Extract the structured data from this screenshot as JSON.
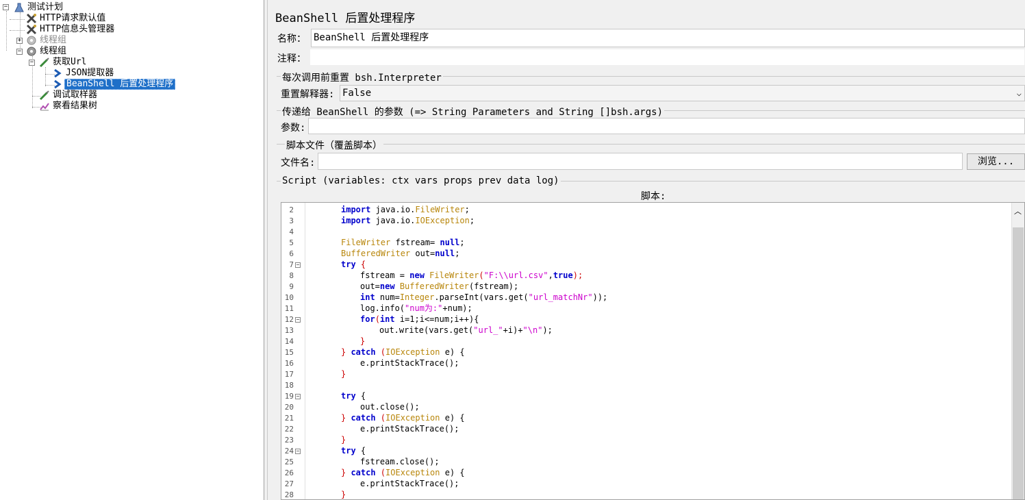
{
  "tree": {
    "items": [
      {
        "label": "测试计划",
        "icon": "test-plan-icon",
        "level": 0
      },
      {
        "label": "HTTP请求默认值",
        "icon": "wrench-icon",
        "level": 1
      },
      {
        "label": "HTTP信息头管理器",
        "icon": "wrench-icon",
        "level": 1
      },
      {
        "label": "线程组",
        "icon": "thread-group-icon",
        "level": 1,
        "disabled": true
      },
      {
        "label": "线程组",
        "icon": "thread-group-icon",
        "level": 1
      },
      {
        "label": "获取Url",
        "icon": "sampler-icon",
        "level": 2
      },
      {
        "label": "JSON提取器",
        "icon": "post-processor-icon",
        "level": 3
      },
      {
        "label": "BeanShell 后置处理程序",
        "icon": "post-processor-icon",
        "level": 3,
        "selected": true
      },
      {
        "label": "调试取样器",
        "icon": "sampler-icon",
        "level": 2
      },
      {
        "label": "察看结果树",
        "icon": "listener-icon",
        "level": 2
      }
    ]
  },
  "panel": {
    "title": "BeanShell 后置处理程序",
    "name_label": "名称：",
    "name_value": "BeanShell 后置处理程序",
    "comment_label": "注释：",
    "comment_value": "",
    "reset_group_title": "每次调用前重置 bsh.Interpreter",
    "reset_label": "重置解释器:",
    "reset_value": "False",
    "params_group_title": "传递给 BeanShell 的参数 (=> String Parameters and String []bsh.args)",
    "params_label": "参数:",
    "params_value": "",
    "file_group_title": "脚本文件（覆盖脚本）",
    "file_label": "文件名:",
    "file_value": "",
    "browse_label": "浏览...",
    "script_group_title": "Script (variables: ctx vars props prev data log)",
    "script_label": "脚本:"
  },
  "script_lines": [
    {
      "n": "2",
      "fold": false
    },
    {
      "n": "3",
      "fold": false
    },
    {
      "n": "4",
      "fold": false
    },
    {
      "n": "5",
      "fold": false
    },
    {
      "n": "6",
      "fold": false
    },
    {
      "n": "7",
      "fold": true
    },
    {
      "n": "8",
      "fold": false
    },
    {
      "n": "9",
      "fold": false
    },
    {
      "n": "10",
      "fold": false
    },
    {
      "n": "11",
      "fold": false
    },
    {
      "n": "12",
      "fold": true
    },
    {
      "n": "13",
      "fold": false
    },
    {
      "n": "14",
      "fold": false
    },
    {
      "n": "15",
      "fold": false
    },
    {
      "n": "16",
      "fold": false
    },
    {
      "n": "17",
      "fold": false
    },
    {
      "n": "18",
      "fold": false
    },
    {
      "n": "19",
      "fold": true
    },
    {
      "n": "20",
      "fold": false
    },
    {
      "n": "21",
      "fold": false
    },
    {
      "n": "22",
      "fold": false
    },
    {
      "n": "23",
      "fold": false
    },
    {
      "n": "24",
      "fold": true
    },
    {
      "n": "25",
      "fold": false
    },
    {
      "n": "26",
      "fold": false
    },
    {
      "n": "27",
      "fold": false
    },
    {
      "n": "28",
      "fold": false
    }
  ],
  "code": {
    "l2": [
      "import",
      " java.io.",
      "FileWriter",
      ";"
    ],
    "l3": [
      "import",
      " java.io.",
      "IOException",
      ";"
    ],
    "l5": [
      "FileWriter",
      " fstream= ",
      "null",
      ";"
    ],
    "l6": [
      "BufferedWriter",
      " out=",
      "null",
      ";"
    ],
    "l7": [
      "try",
      " ",
      "{"
    ],
    "l8": [
      "fstream = ",
      "new",
      " ",
      "FileWriter",
      "(",
      "\"F:\\\\url.csv\"",
      ",",
      "true",
      ");"
    ],
    "l9": [
      "out=",
      "new",
      " ",
      "BufferedWriter",
      "(fstream);"
    ],
    "l10": [
      "int",
      " num=",
      "Integer",
      ".parseInt(vars.get(",
      "\"url_matchNr\"",
      "));"
    ],
    "l11": [
      "log.info(",
      "\"num为:\"",
      "+num);"
    ],
    "l12": [
      "for",
      "(",
      "int",
      " i=1;i<=num;i++){"
    ],
    "l13": [
      "out.write(vars.get(",
      "\"url_\"",
      "+i)+",
      "\"\\n\"",
      ");"
    ],
    "l14": [
      "}"
    ],
    "l15": [
      "} ",
      "catch",
      " (",
      "IOException",
      " e) {"
    ],
    "l16": [
      "e.printStackTrace();"
    ],
    "l17": [
      "}"
    ],
    "l19": [
      "try",
      " {"
    ],
    "l20": [
      "out.close();"
    ],
    "l21": [
      "} ",
      "catch",
      " (",
      "IOException",
      " e) {"
    ],
    "l22": [
      "e.printStackTrace();"
    ],
    "l23": [
      "}"
    ],
    "l24": [
      "try",
      " {"
    ],
    "l25": [
      "fstream.close();"
    ],
    "l26": [
      "} ",
      "catch",
      " (",
      "IOException",
      " e) {"
    ],
    "l27": [
      "e.printStackTrace();"
    ],
    "l28": [
      "}"
    ]
  }
}
